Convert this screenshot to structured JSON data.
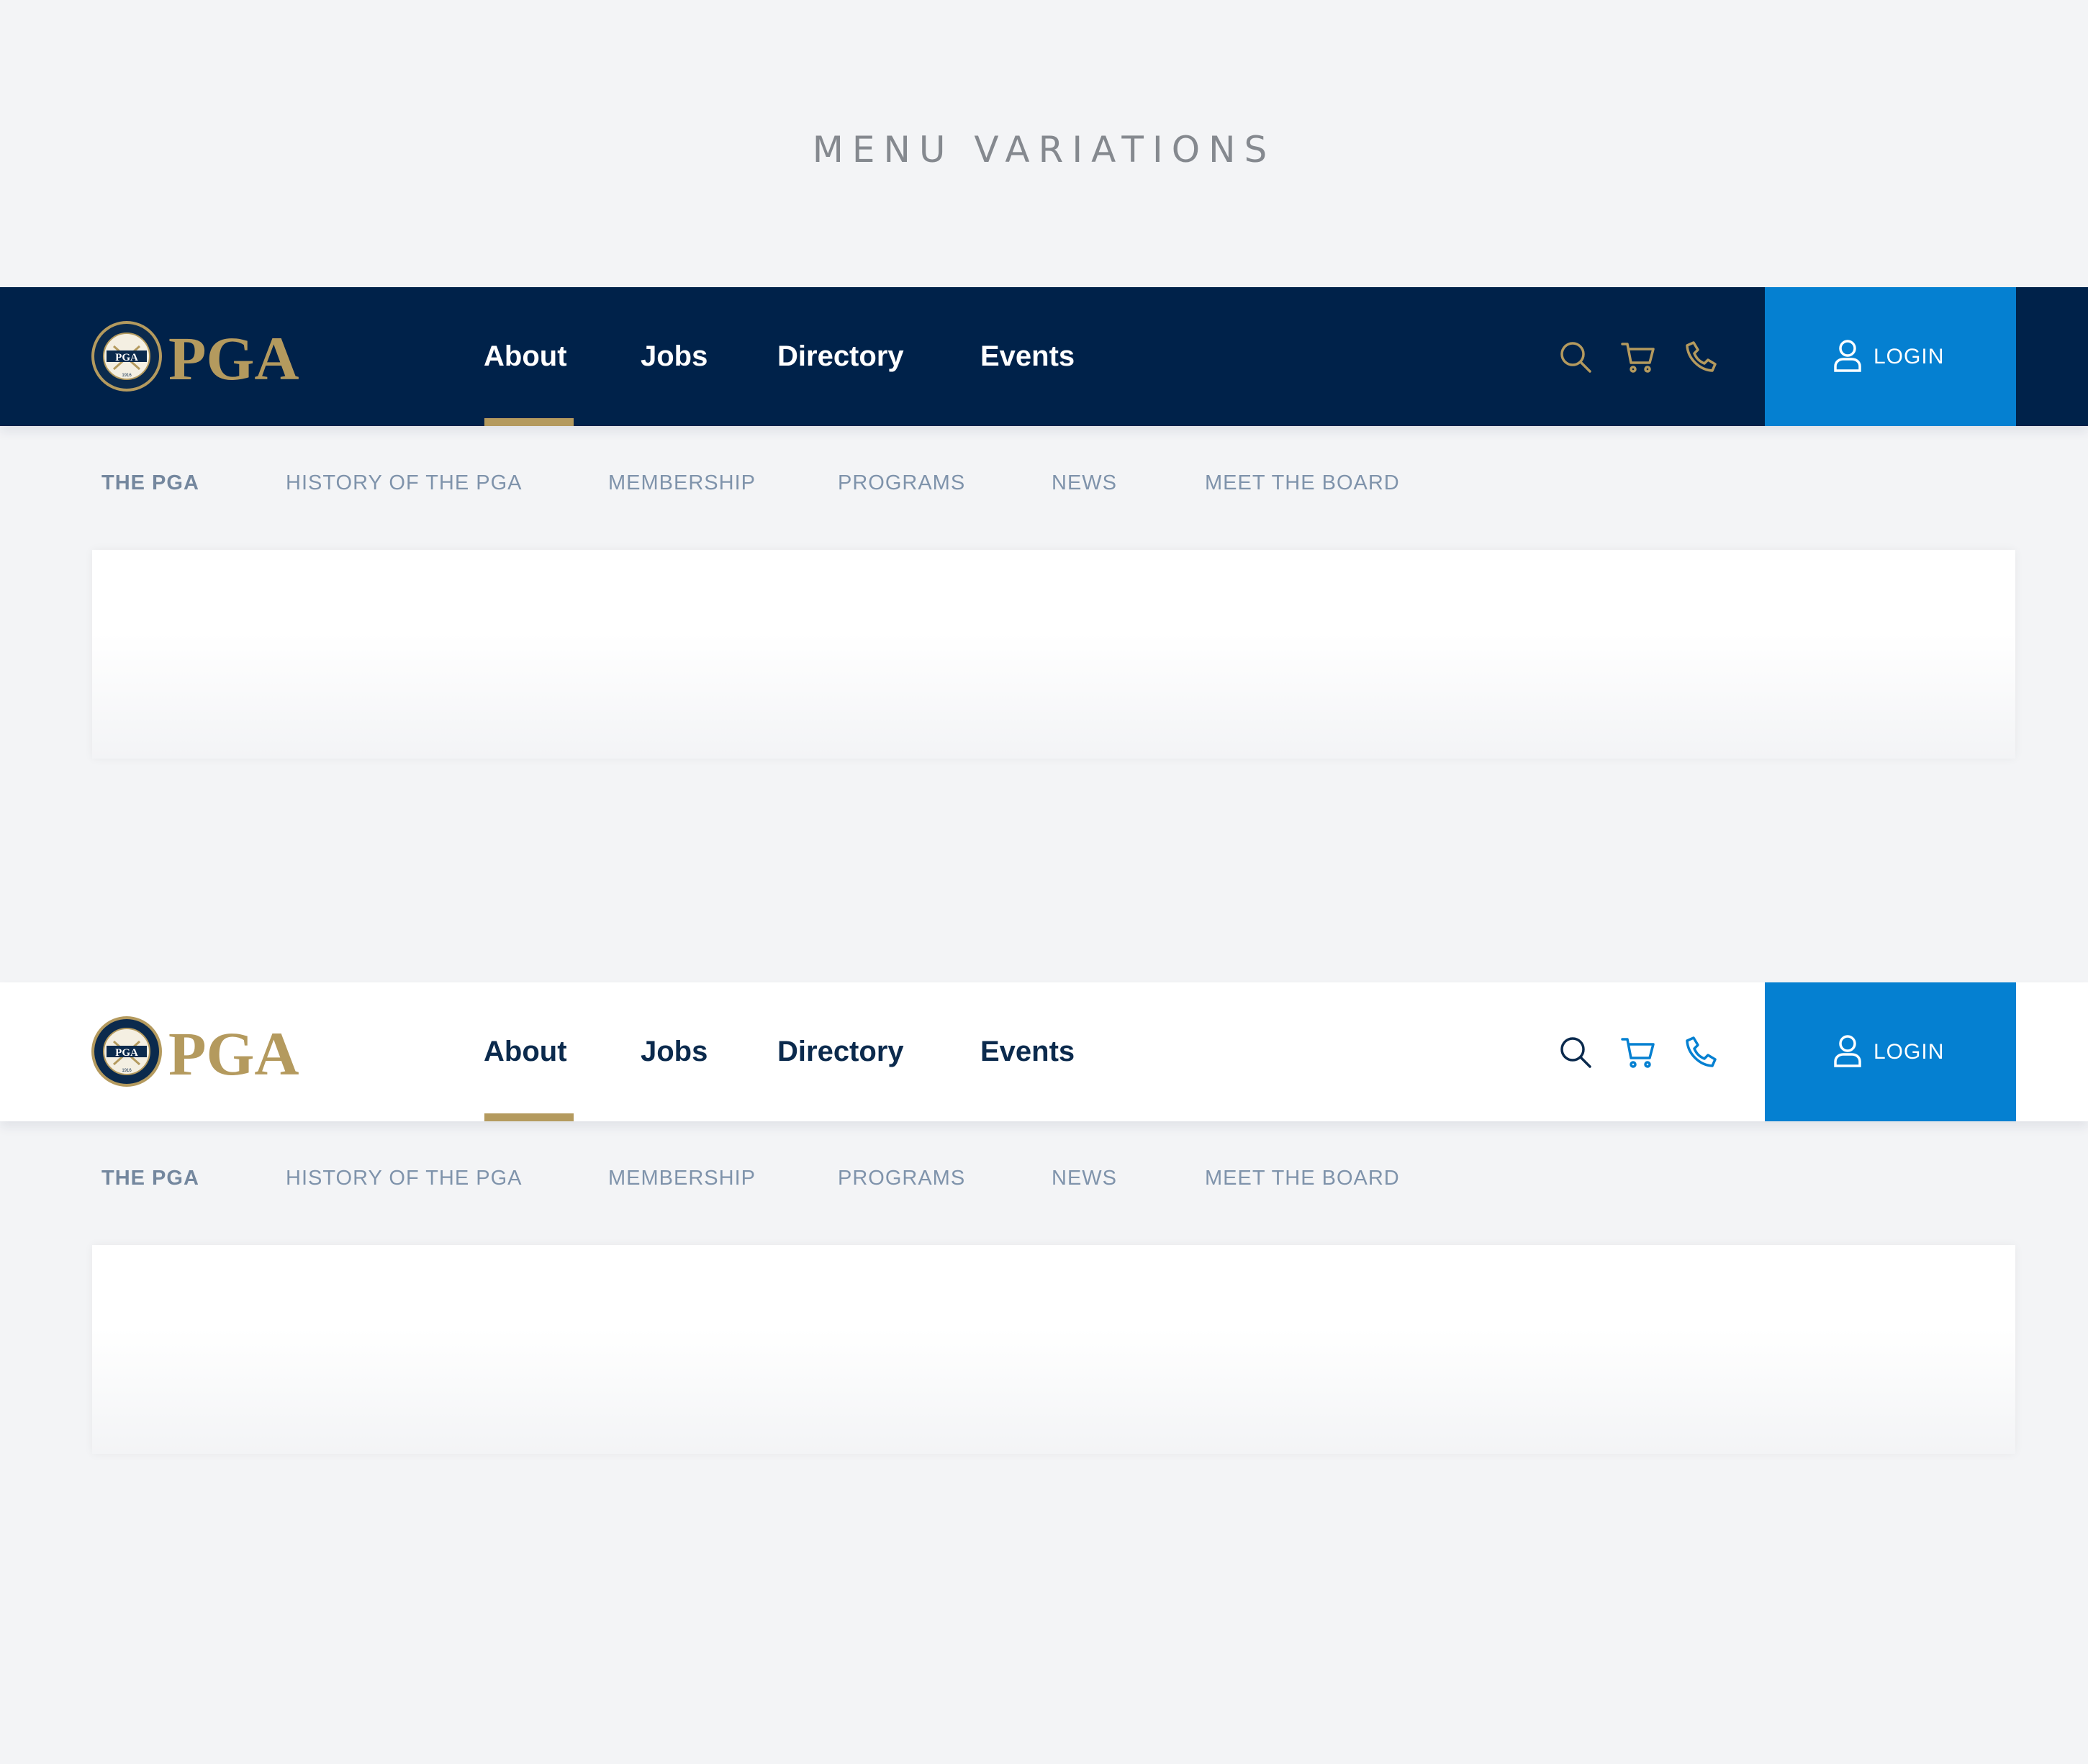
{
  "page_title": "MENU VARIATIONS",
  "colors": {
    "navy": "#00224a",
    "gold": "#b49a5e",
    "login_blue": "#0580d1",
    "subnav_text": "#7f93ab",
    "background": "#f3f4f6"
  },
  "logo": {
    "wordmark": "PGA",
    "seal_text": "PGA",
    "seal_ring_text": "PROFESSIONAL GOLFERS' ASSOCIATION OF AMERICA",
    "seal_year": "1916"
  },
  "variants": [
    {
      "theme": "dark",
      "nav": {
        "items": [
          "About",
          "Jobs",
          "Directory",
          "Events"
        ],
        "active": "About"
      },
      "icons": [
        "search-icon",
        "cart-icon",
        "phone-icon"
      ],
      "icon_color": "#b49a5e",
      "login_label": "LOGIN",
      "subnav": [
        "THE PGA",
        "HISTORY OF THE PGA",
        "MEMBERSHIP",
        "PROGRAMS",
        "NEWS",
        "MEET THE BOARD"
      ]
    },
    {
      "theme": "light",
      "nav": {
        "items": [
          "About",
          "Jobs",
          "Directory",
          "Events"
        ],
        "active": "About"
      },
      "icons": [
        "search-icon",
        "cart-icon",
        "phone-icon"
      ],
      "icon_color": "#0580d1",
      "login_label": "LOGIN",
      "subnav": [
        "THE PGA",
        "HISTORY OF THE PGA",
        "MEMBERSHIP",
        "PROGRAMS",
        "NEWS",
        "MEET THE BOARD"
      ]
    }
  ]
}
